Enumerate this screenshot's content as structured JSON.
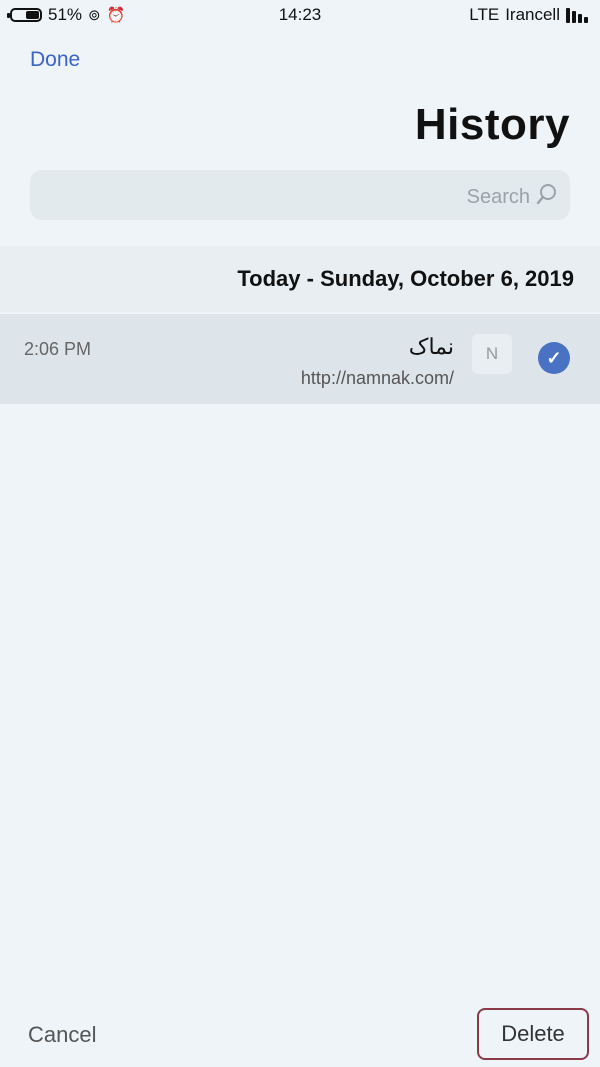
{
  "status_bar": {
    "battery_percent": "51%",
    "battery_level": 0.51,
    "time": "14:23",
    "carrier": "Irancell",
    "network": "LTE",
    "icons": [
      "lock-rotation-icon",
      "alarm-icon",
      "signal-icon"
    ]
  },
  "nav": {
    "done_label": "Done",
    "title": "History"
  },
  "search": {
    "placeholder": "Search"
  },
  "sections": [
    {
      "header": "Today - Sunday, October 6, 2019",
      "items": [
        {
          "title": "نماک",
          "url": "http://namnak.com/",
          "time": "2:06 PM",
          "favicon_letter": "N",
          "selected": true
        }
      ]
    }
  ],
  "toolbar": {
    "cancel_label": "Cancel",
    "delete_label": "Delete"
  },
  "colors": {
    "accent": "#3b63c8",
    "check": "#4a72c4",
    "background": "#eef4f8",
    "delete_border": "#8b3a4a"
  }
}
